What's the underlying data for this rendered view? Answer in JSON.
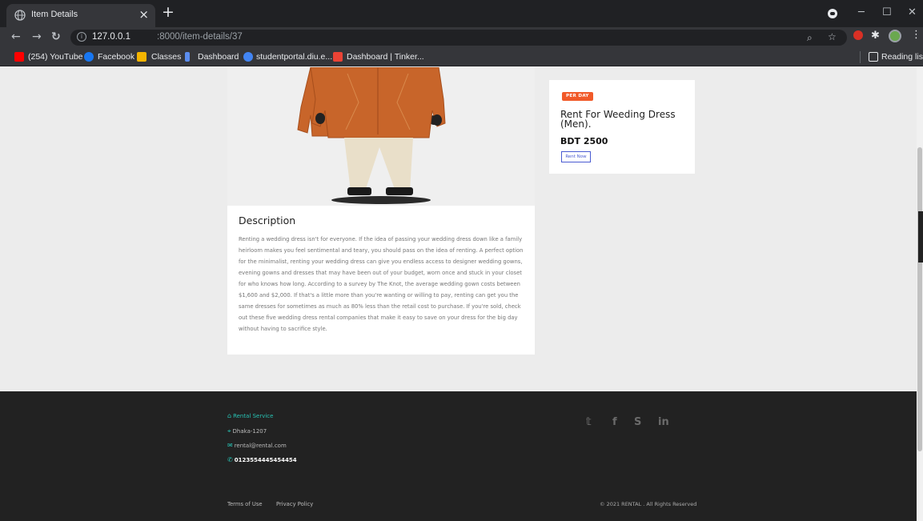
{
  "browser": {
    "tab_title": "Item Details",
    "tab_close": "×",
    "new_tab": "+",
    "url_host": "127.0.0.1",
    "url_path": ":8000/item-details/37",
    "window_controls": {
      "minimize": "─",
      "maximize": "☐",
      "close": "✕"
    },
    "bookmarks": [
      {
        "label": "(254) YouTube",
        "color": "#ff0000"
      },
      {
        "label": "Facebook",
        "color": "#1877f2"
      },
      {
        "label": "Classes",
        "color": "#f4b400"
      },
      {
        "label": "Dashboard",
        "color": "#5b8def"
      },
      {
        "label": "studentportal.diu.e...",
        "color": "#4285f4"
      },
      {
        "label": "Dashboard | Tinker...",
        "color": "#ea4335"
      }
    ],
    "reading_list": "Reading list"
  },
  "item": {
    "badge": "PER DAY",
    "title": "Rent For Weeding Dress (Men).",
    "price": "BDT 2500",
    "rent_button": "Rent Now"
  },
  "description": {
    "heading": "Description",
    "text": "Renting a wedding dress isn't for everyone. If the idea of passing your wedding dress down like a family heirloom makes you feel sentimental and teary, you should pass on the idea of renting. A perfect option for the minimalist, renting your wedding dress can give you endless access to designer wedding gowns, evening gowns and dresses that may have been out of your budget, worn once and stuck in your closet for who knows how long. According to a survey by The Knot, the average wedding gown costs between $1,600 and $2,000. If that's a little more than you're wanting or willing to pay, renting can get you the same dresses for sometimes as much as 80% less than the retail cost to purchase. If you're sold, check out these five wedding dress rental companies that make it easy to save on your dress for the big day without having to sacrifice style."
  },
  "footer": {
    "brand": "Rental Service",
    "address": "Dhaka-1207",
    "email": "rental@rental.com",
    "phone": "0123554445454454",
    "social": [
      "twitter-icon",
      "facebook-icon",
      "skype-icon",
      "linkedin-icon"
    ],
    "links": [
      "Terms of Use",
      "Privacy Policy"
    ],
    "copyright": "© 2021 RENTAL . All Rights Reserved"
  }
}
